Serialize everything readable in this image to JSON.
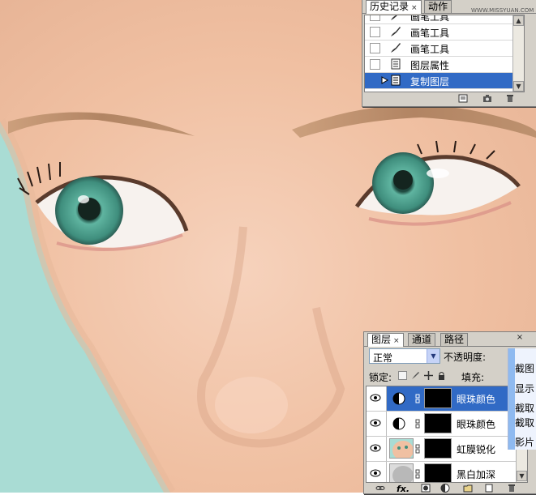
{
  "history_panel": {
    "tabs": [
      "历史记录",
      "动作"
    ],
    "watermark": "WWW.MISSYUAN.COM",
    "items": [
      {
        "label": "画笔工具",
        "icon": "brush-icon",
        "selected": false
      },
      {
        "label": "画笔工具",
        "icon": "brush-icon",
        "selected": false
      },
      {
        "label": "画笔工具",
        "icon": "brush-icon",
        "selected": false
      },
      {
        "label": "图层属性",
        "icon": "document-icon",
        "selected": false
      },
      {
        "label": "复制图层",
        "icon": "document-icon",
        "selected": true
      }
    ]
  },
  "layers_panel": {
    "tabs": [
      "图层",
      "通道",
      "路径"
    ],
    "blend_mode": "正常",
    "opacity_label": "不透明度:",
    "lock_label": "锁定:",
    "fill_label": "填充:",
    "layers": [
      {
        "name": "眼珠颜色",
        "type": "adjustment",
        "selected": true
      },
      {
        "name": "眼珠颜色",
        "type": "adjustment",
        "selected": false
      },
      {
        "name": "虹膜锐化",
        "type": "image",
        "selected": false
      },
      {
        "name": "黑白加深",
        "type": "image",
        "selected": false
      }
    ]
  },
  "context_menu": {
    "items": [
      "截图",
      "显示",
      "截取",
      "截取",
      "影片"
    ]
  },
  "colors": {
    "selection": "#316ac5",
    "panel_bg": "#d4d0c8",
    "skin": "#f1c3a6",
    "iris": "#4a9c8a"
  }
}
